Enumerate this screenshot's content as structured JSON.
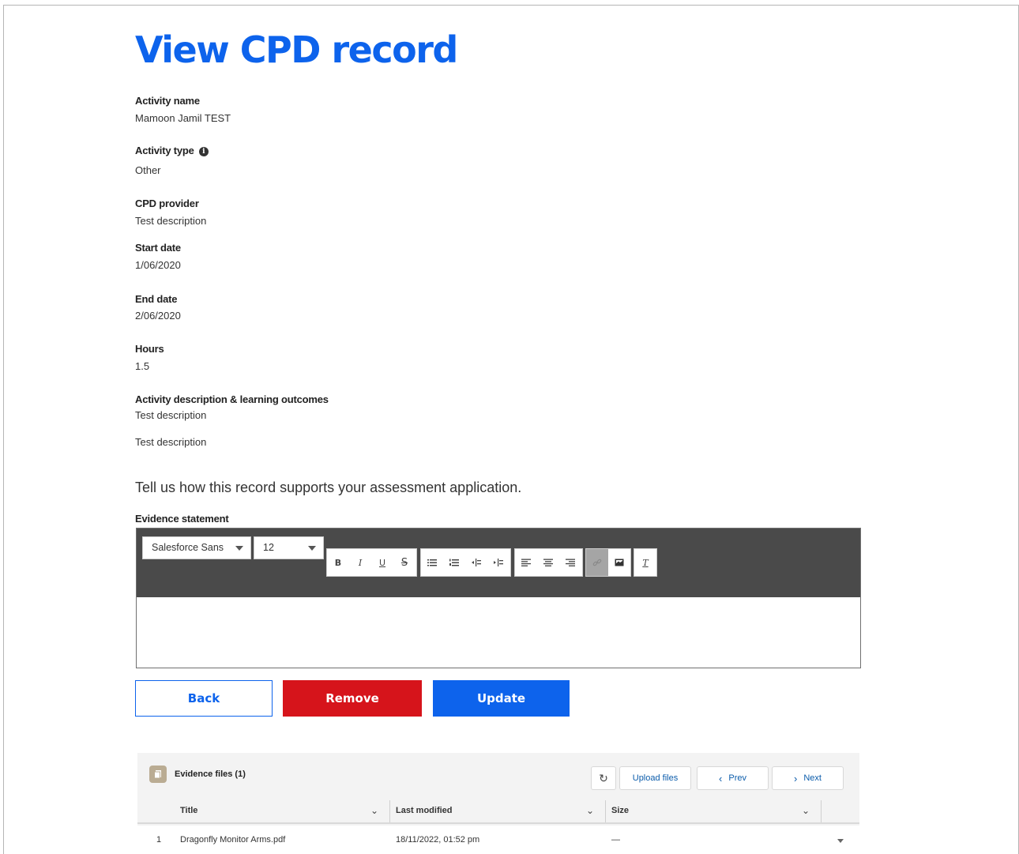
{
  "page": {
    "title": "View CPD record",
    "prompt": "Tell us how this record supports your assessment application."
  },
  "fields": {
    "activity_name": {
      "label": "Activity name",
      "value": "Mamoon Jamil TEST"
    },
    "activity_type": {
      "label": "Activity type",
      "value": "Other",
      "icon": "info-icon"
    },
    "cpd_provider": {
      "label": "CPD provider",
      "value": "Test description"
    },
    "start_date": {
      "label": "Start date",
      "value": "1/06/2020"
    },
    "end_date": {
      "label": "End date",
      "value": "2/06/2020"
    },
    "hours": {
      "label": "Hours",
      "value": "1.5"
    },
    "description": {
      "label": "Activity description & learning outcomes",
      "value": "Test description",
      "value2": "Test description"
    }
  },
  "evidence": {
    "label": "Evidence statement",
    "font_family": "Salesforce Sans",
    "font_size": "12",
    "body": ""
  },
  "actions": {
    "back": "Back",
    "remove": "Remove",
    "update": "Update"
  },
  "files": {
    "title": "Evidence files (1)",
    "upload_label": "Upload files",
    "prev_label": "Prev",
    "next_label": "Next",
    "columns": [
      "Title",
      "Last modified",
      "Size"
    ],
    "rows": [
      {
        "num": "1",
        "title": "Dragonfly Monitor Arms.pdf",
        "modified": "18/11/2022, 01:52 pm",
        "size": "—"
      }
    ]
  },
  "colors": {
    "primary": "#0d63ec",
    "danger": "#d6141b",
    "toolbar": "#4a4a4a"
  }
}
